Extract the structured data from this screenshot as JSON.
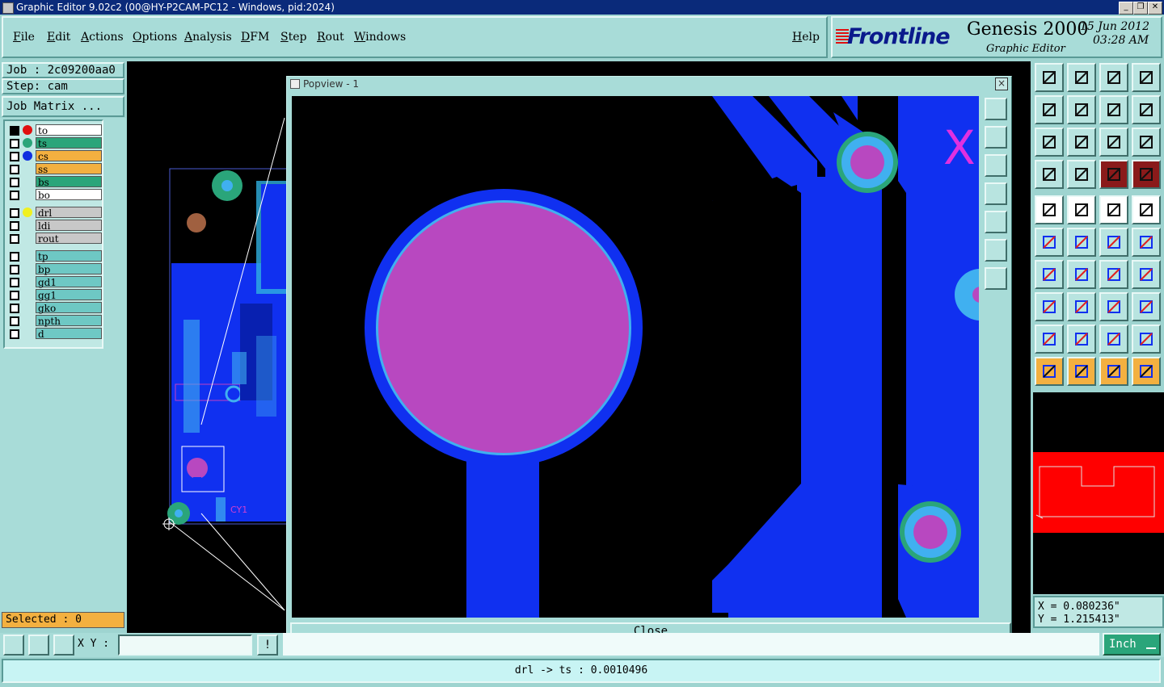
{
  "window": {
    "title": "Graphic Editor 9.02c2 (00@HY-P2CAM-PC12 - Windows, pid:2024)"
  },
  "menu": [
    "File",
    "Edit",
    "Actions",
    "Options",
    "Analysis",
    "DFM",
    "Step",
    "Rout",
    "Windows"
  ],
  "help": "Help",
  "brand": {
    "logo": "Frontline",
    "product": "Genesis 2000",
    "subtitle": "Graphic Editor",
    "date": "15 Jun 2012",
    "time": "03:28 AM"
  },
  "job": {
    "job": "Job : 2c09200aa0",
    "step": "Step: cam",
    "matrix_button": "Job Matrix ..."
  },
  "layers": [
    {
      "name": "to",
      "color": "#ffffff",
      "dot": "#e01010",
      "group": 0
    },
    {
      "name": "ts",
      "color": "#2aa57a",
      "dot": "#2aa57a",
      "group": 0
    },
    {
      "name": "cs",
      "color": "#f3b040",
      "dot": "#1030e0",
      "group": 0
    },
    {
      "name": "ss",
      "color": "#f3b040",
      "dot": "",
      "group": 0
    },
    {
      "name": "bs",
      "color": "#2aa57a",
      "dot": "",
      "group": 0
    },
    {
      "name": "bo",
      "color": "#ffffff",
      "dot": "",
      "group": 0
    },
    {
      "name": "drl",
      "color": "#c8c8c8",
      "dot": "#f0f020",
      "group": 1
    },
    {
      "name": "ldi",
      "color": "#c8c8c8",
      "dot": "",
      "group": 1
    },
    {
      "name": "rout",
      "color": "#c8c8c8",
      "dot": "",
      "group": 1
    },
    {
      "name": "tp",
      "color": "#6ec8c4",
      "dot": "",
      "group": 2
    },
    {
      "name": "bp",
      "color": "#6ec8c4",
      "dot": "",
      "group": 2
    },
    {
      "name": "gd1",
      "color": "#6ec8c4",
      "dot": "",
      "group": 2
    },
    {
      "name": "gg1",
      "color": "#6ec8c4",
      "dot": "",
      "group": 2
    },
    {
      "name": "gko",
      "color": "#6ec8c4",
      "dot": "",
      "group": 2
    },
    {
      "name": "npth",
      "color": "#6ec8c4",
      "dot": "",
      "group": 2
    },
    {
      "name": "d",
      "color": "#6ec8c4",
      "dot": "",
      "group": 2
    }
  ],
  "popview": {
    "title": "Popview - 1",
    "close_label": "Close",
    "close_x": "×",
    "marker": "X"
  },
  "board_label": "CY1",
  "selected": "Selected : 0",
  "coords": {
    "x": "X = 0.080236\"",
    "y": "Y = 1.215413\""
  },
  "xy_label": "X Y :",
  "xy_value": "",
  "exclaim": "!",
  "units": "Inch",
  "status": "drl -> ts : 0.0010496",
  "colors": {
    "trace": "#1030f0",
    "pad": "#b848c0",
    "pad_ring": "#40b0f0",
    "ts_ring": "#2aa57a"
  }
}
